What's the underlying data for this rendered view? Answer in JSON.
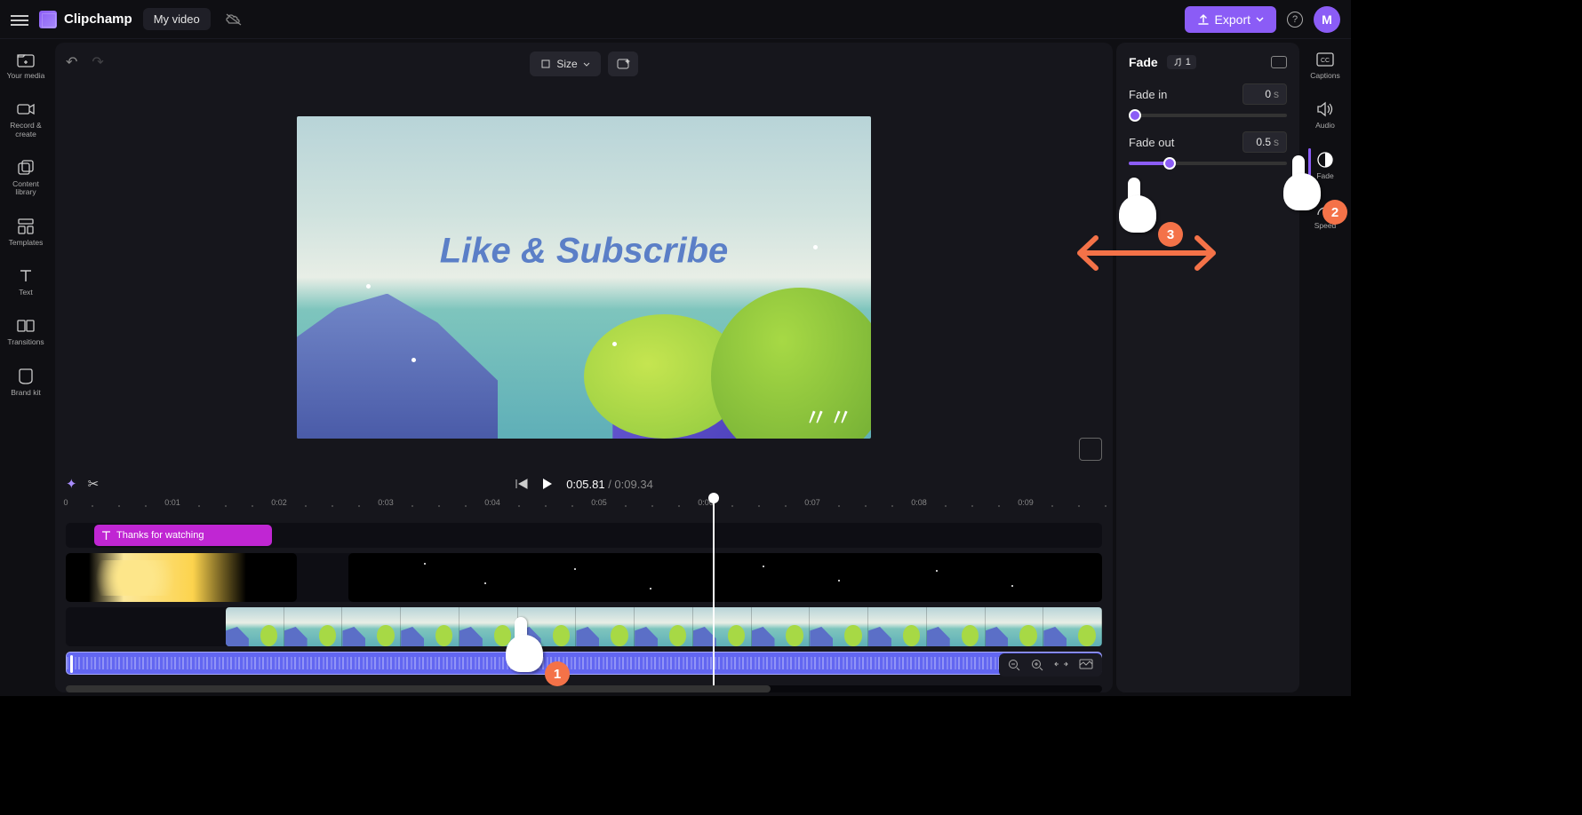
{
  "app": {
    "name": "Clipchamp",
    "title": "My video",
    "export_label": "Export",
    "avatar_letter": "M"
  },
  "left_rail": {
    "items": [
      {
        "label": "Your media"
      },
      {
        "label": "Record & create"
      },
      {
        "label": "Content library"
      },
      {
        "label": "Templates"
      },
      {
        "label": "Text"
      },
      {
        "label": "Transitions"
      },
      {
        "label": "Brand kit"
      }
    ]
  },
  "right_rail": {
    "items": [
      {
        "label": "Captions"
      },
      {
        "label": "Audio"
      },
      {
        "label": "Fade"
      },
      {
        "label": "Speed"
      }
    ]
  },
  "canvas": {
    "size_label": "Size",
    "overlay_text": "Like & Subscribe"
  },
  "playback": {
    "current": "0:05.81",
    "duration": "0:09.34"
  },
  "ruler": [
    "0",
    "0:01",
    "0:02",
    "0:03",
    "0:04",
    "0:05",
    "0:06",
    "0:07",
    "0:08",
    "0:09"
  ],
  "timeline": {
    "text_clip_label": "Thanks for watching"
  },
  "fade_panel": {
    "title": "Fade",
    "track_count": "1",
    "fade_in_label": "Fade in",
    "fade_in_value": "0",
    "fade_in_unit": "s",
    "fade_out_label": "Fade out",
    "fade_out_value": "0.5",
    "fade_out_unit": "s"
  },
  "callouts": {
    "c1": "1",
    "c2": "2",
    "c3": "3"
  }
}
